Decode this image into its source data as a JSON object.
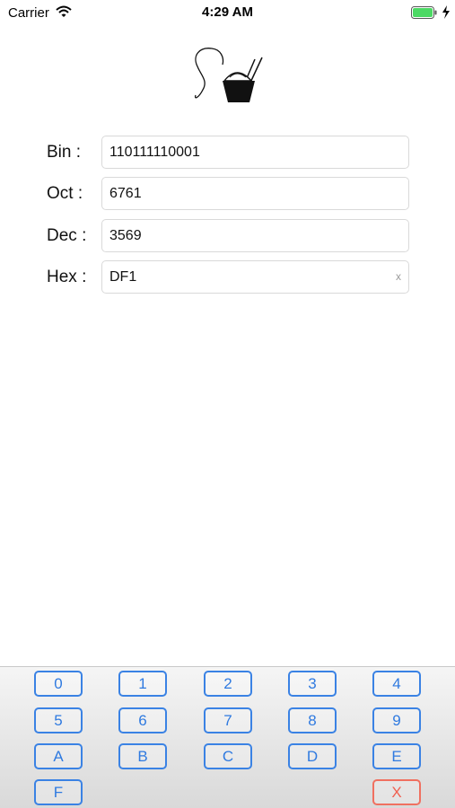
{
  "status_bar": {
    "carrier": "Carrier",
    "time": "4:29 AM",
    "battery_color": "#4cd964"
  },
  "logo": {
    "icon": "takeout-box-logo-icon"
  },
  "form": {
    "rows": [
      {
        "label": "Bin  :",
        "value": "110111110001"
      },
      {
        "label": "Oct :",
        "value": "6761"
      },
      {
        "label": "Dec :",
        "value": "3569"
      },
      {
        "label": "Hex :",
        "value": "DF1",
        "clear": "x"
      }
    ]
  },
  "keypad": {
    "accent": "#3a82e4",
    "danger": "#f06050",
    "keys": [
      "0",
      "1",
      "2",
      "3",
      "4",
      "5",
      "6",
      "7",
      "8",
      "9",
      "A",
      "B",
      "C",
      "D",
      "E",
      "F",
      "X"
    ]
  }
}
